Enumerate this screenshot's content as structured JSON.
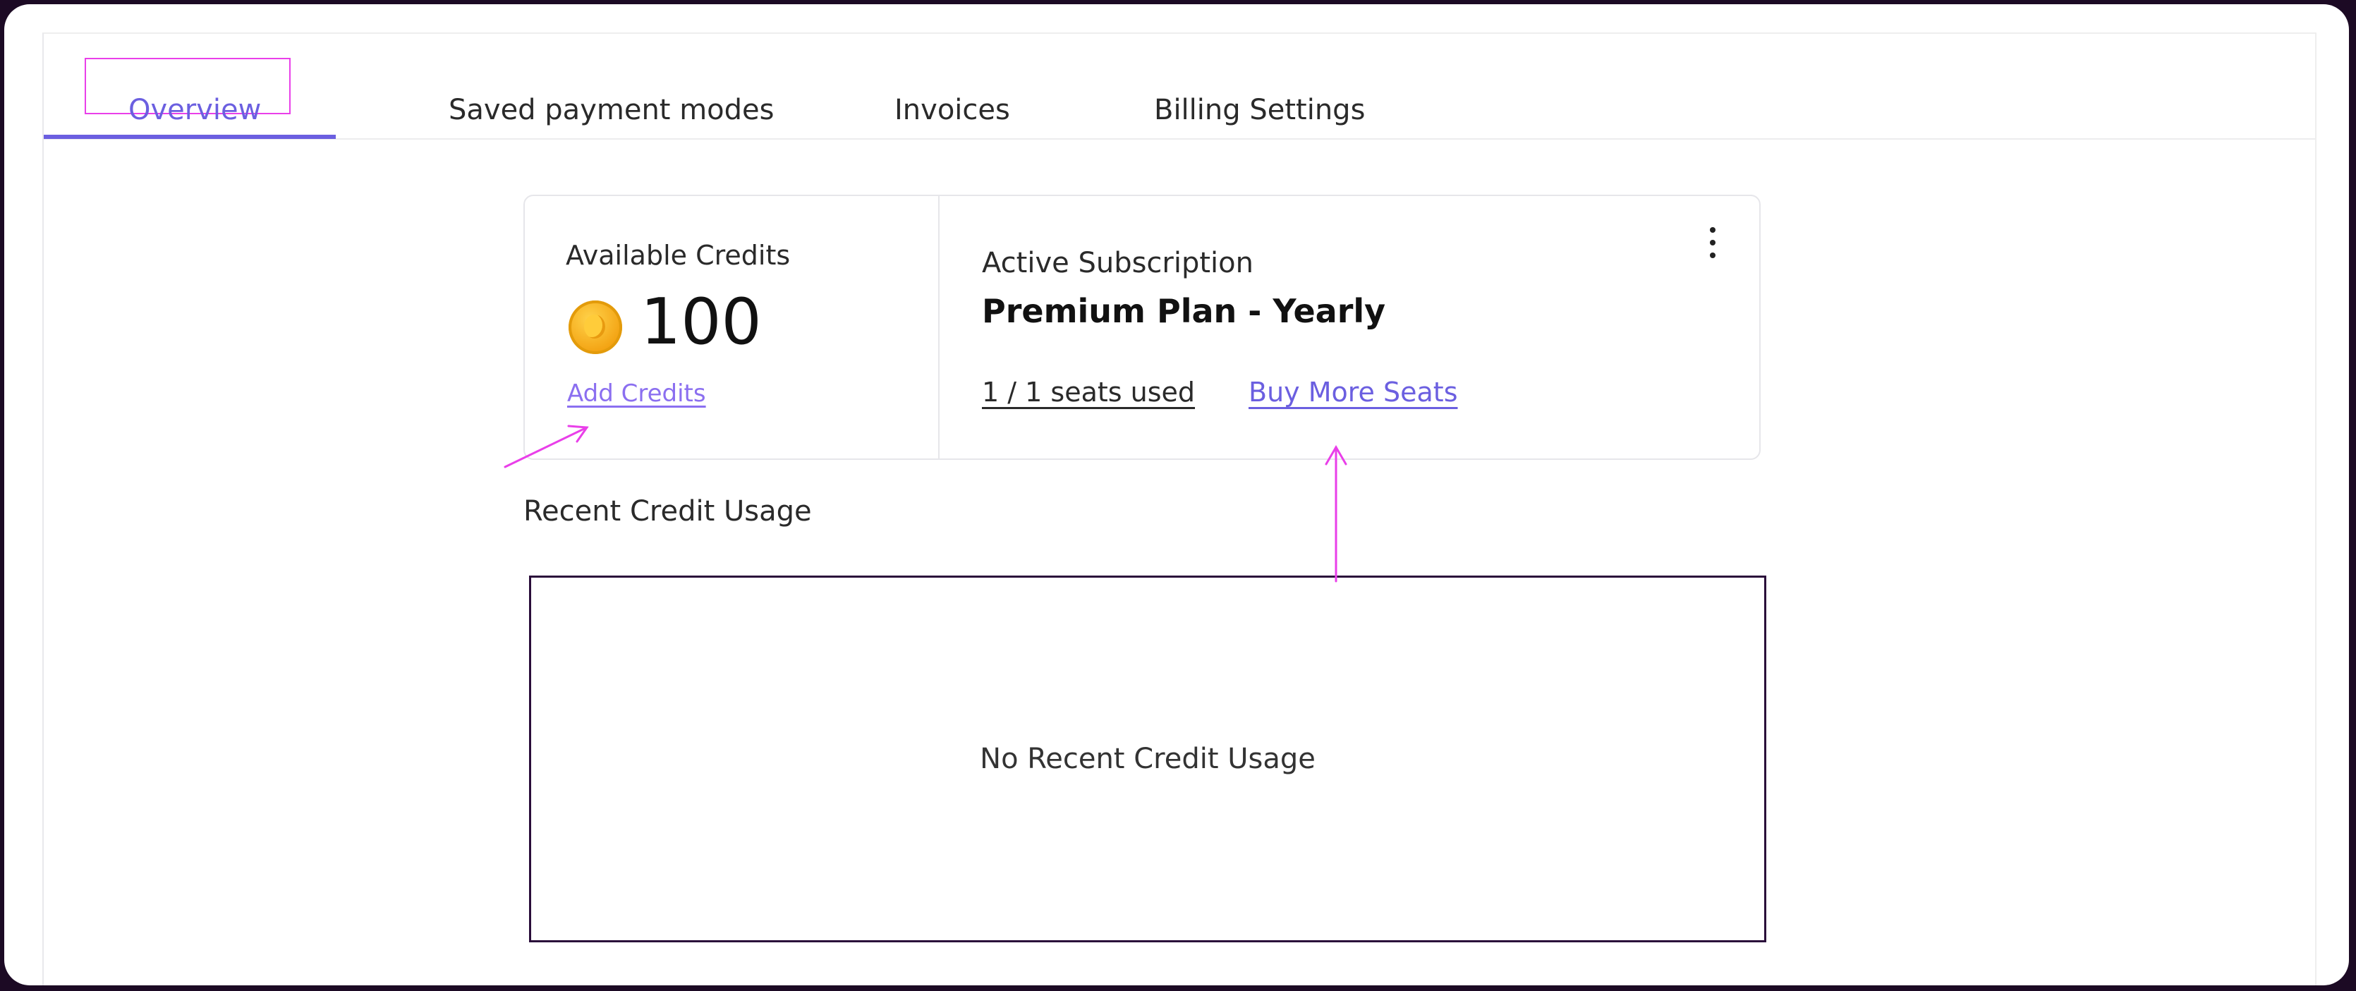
{
  "tabs": [
    {
      "label": "Overview",
      "active": true
    },
    {
      "label": "Saved payment modes",
      "active": false
    },
    {
      "label": "Invoices",
      "active": false
    },
    {
      "label": "Billing Settings",
      "active": false
    }
  ],
  "credits": {
    "label": "Available Credits",
    "value": "100",
    "add_label": "Add Credits"
  },
  "subscription": {
    "label": "Active Subscription",
    "plan": "Premium Plan - Yearly",
    "seats": "1 / 1 seats used",
    "buy_label": "Buy More Seats"
  },
  "recent": {
    "title": "Recent Credit Usage",
    "empty_text": "No Recent Credit Usage"
  },
  "colors": {
    "accent": "#6b5fe0",
    "annotation": "#e93fe9"
  }
}
